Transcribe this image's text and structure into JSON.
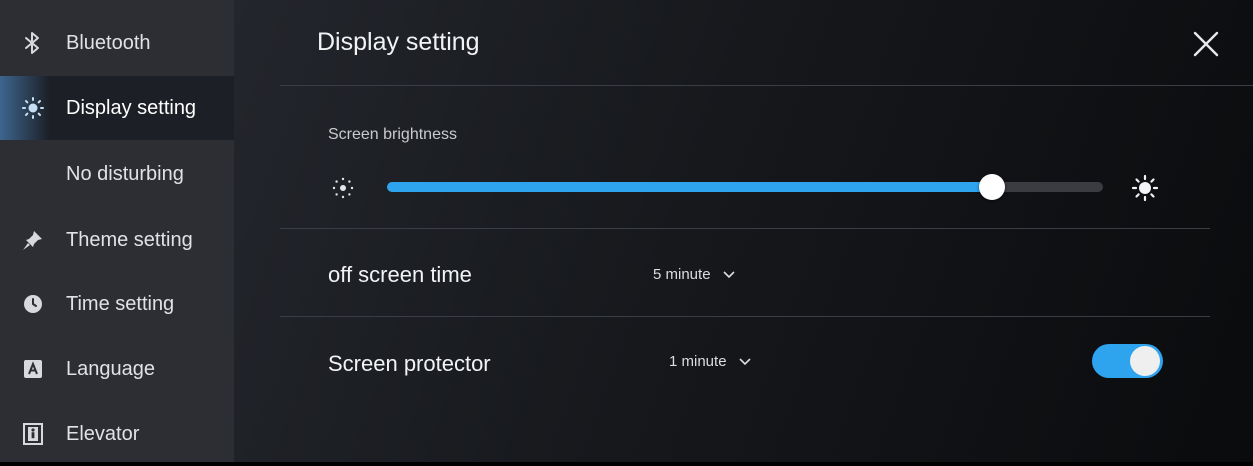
{
  "sidebar": {
    "items": [
      {
        "label": "Bluetooth",
        "icon": "bluetooth-icon"
      },
      {
        "label": "Display setting",
        "icon": "brightness-icon",
        "active": true
      },
      {
        "label": "No disturbing",
        "icon": "moon-icon"
      },
      {
        "label": "Theme setting",
        "icon": "pin-icon"
      },
      {
        "label": "Time setting",
        "icon": "clock-icon"
      },
      {
        "label": "Language",
        "icon": "language-icon"
      },
      {
        "label": "Elevator",
        "icon": "elevator-icon"
      }
    ]
  },
  "main": {
    "title": "Display setting",
    "brightness": {
      "label": "Screen brightness",
      "value_fraction": 0.845
    },
    "off_screen": {
      "label": "off screen time",
      "value": "5 minute"
    },
    "protector": {
      "label": "Screen protector",
      "value": "1 minute",
      "enabled": true
    }
  },
  "colors": {
    "accent": "#2ea4ef",
    "sidebar_bg": "#2c2e33",
    "active_item_bg": "#1c1f25"
  }
}
